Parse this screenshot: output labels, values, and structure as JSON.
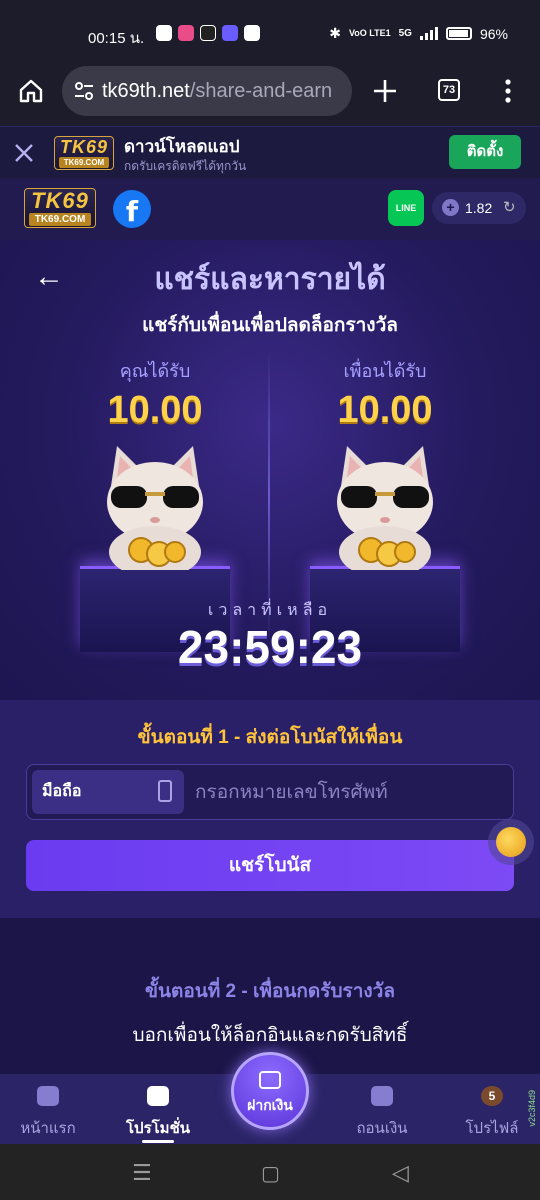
{
  "status": {
    "time": "00:15 น.",
    "net_label": "VoO LTE1",
    "net_type": "5G",
    "battery": "96%"
  },
  "browser": {
    "url_host": "tk69th.net",
    "url_path": "/share-and-earn",
    "tab_count": "73"
  },
  "install_banner": {
    "logo_big": "TK69",
    "logo_small": "TK69.COM",
    "title": "ดาวน์โหลดแอป",
    "subtitle": "กดรับเครดิตฟรีได้ทุกวัน",
    "install_label": "ติดตั้ง"
  },
  "header": {
    "logo_big": "TK69",
    "logo_small": "TK69.COM",
    "facebook_label": "f",
    "line_label": "LINE",
    "balance": "1.82"
  },
  "hero": {
    "title": "แชร์และหารายได้",
    "subtitle": "แชร์กับเพื่อนเพื่อปลดล็อกรางวัล",
    "you_receive_label": "คุณได้รับ",
    "you_receive_amount": "10.00",
    "friend_receive_label": "เพื่อนได้รับ",
    "friend_receive_amount": "10.00",
    "time_left_label": "เวลาที่เหลือ",
    "time_left": "23:59:23"
  },
  "step1": {
    "heading": "ขั้นตอนที่ 1 - ส่งต่อโบนัสให้เพื่อน",
    "phone_tag": "มือถือ",
    "phone_placeholder": "กรอกหมายเลขโทรศัพท์",
    "share_button": "แชร์โบนัส"
  },
  "step2": {
    "heading": "ขั้นตอนที่ 2 - เพื่อนกดรับรางวัล",
    "description": "บอกเพื่อนให้ล็อกอินและกดรับสิทธิ์"
  },
  "bottom_nav": {
    "items": [
      {
        "label": "หน้าแรก",
        "icon": "home-icon"
      },
      {
        "label": "โปรโมชั่น",
        "icon": "gift-icon"
      },
      {
        "label": "ฝากเงิน",
        "icon": "deposit-icon"
      },
      {
        "label": "ถอนเงิน",
        "icon": "wallet-icon"
      },
      {
        "label": "โปรไฟล์",
        "icon": "profile-badge-icon"
      }
    ],
    "profile_level": "5",
    "version": "v2c3f4d9"
  },
  "colors": {
    "accent_gold": "#ffc43a",
    "button_purple": "#6a3bf0",
    "install_green": "#1aa65a"
  }
}
